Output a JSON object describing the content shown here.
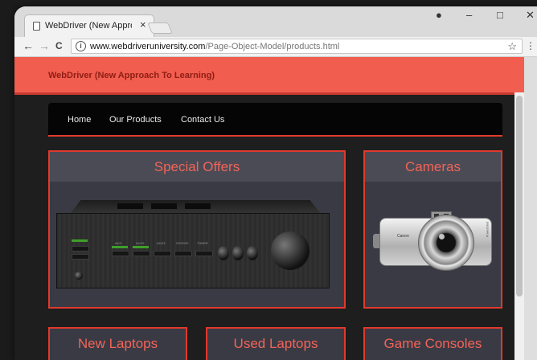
{
  "browser": {
    "tab_title": "WebDriver (New Approa",
    "tab_close": "×",
    "window_controls": {
      "profile": "●",
      "minimize": "–",
      "maximize": "□",
      "close": "✕"
    },
    "nav": {
      "back": "←",
      "forward": "→",
      "reload": "C"
    },
    "address": {
      "host": "www.webdriveruniversity.com",
      "path": "/Page-Object-Model/products.html"
    },
    "star": "☆",
    "menu": "⋮"
  },
  "site": {
    "title": "WebDriver (New Approach To Learning)",
    "nav": [
      "Home",
      "Our Products",
      "Contact Us"
    ]
  },
  "products": {
    "special_offers": "Special Offers",
    "cameras": "Cameras",
    "new_laptops": "New Laptops",
    "used_laptops": "Used Laptops",
    "game_consoles": "Game Consoles"
  },
  "amplifier": {
    "labels": [
      "AUX",
      "AUX2",
      "AUX3",
      "CD/DVD",
      "TUNER"
    ]
  },
  "camera": {
    "brand": "Canon",
    "side_text": "PowerShot"
  }
}
